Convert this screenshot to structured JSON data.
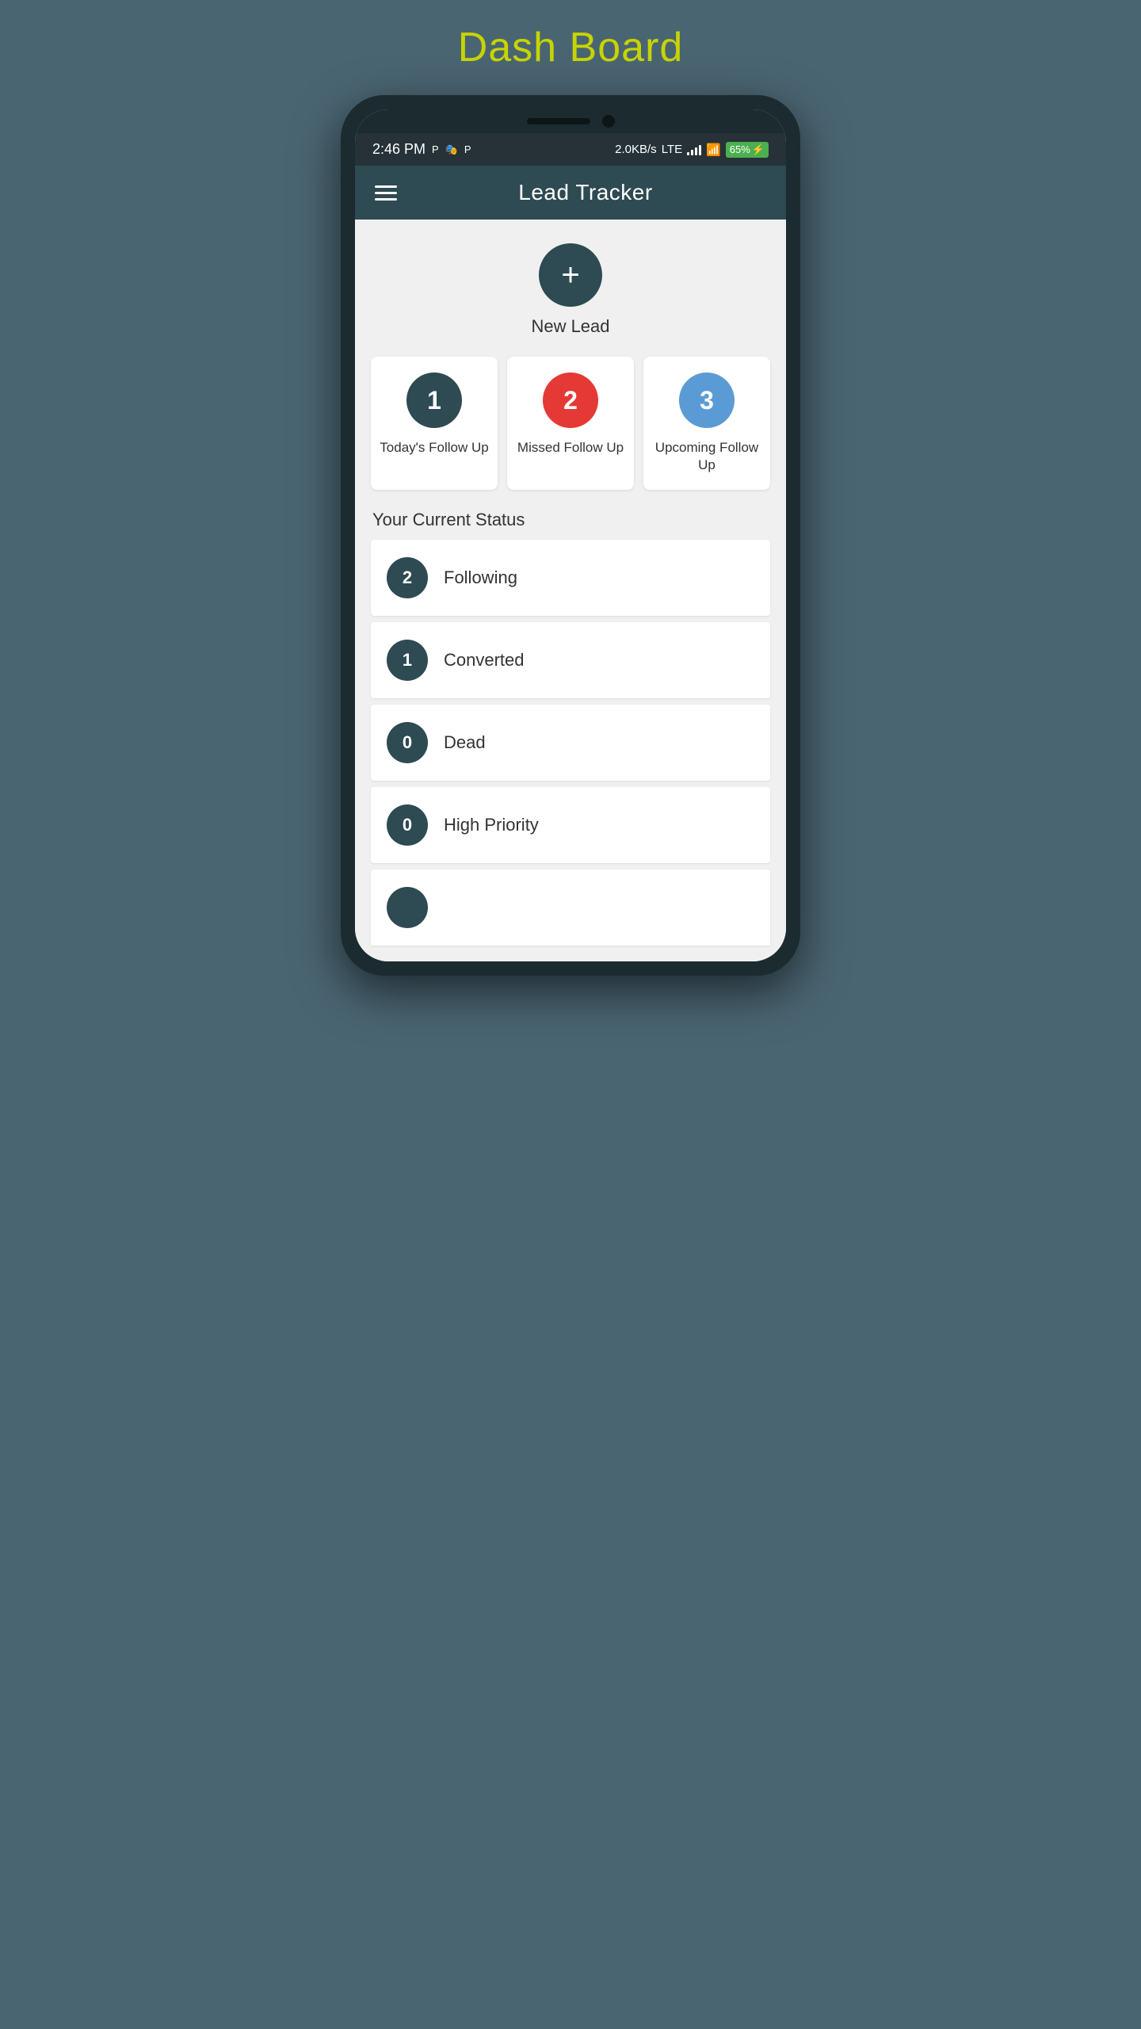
{
  "page": {
    "title_dash": "Dash",
    "title_board": "Board"
  },
  "status_bar": {
    "time": "2:46 PM",
    "network_speed": "2.0KB/s",
    "battery": "65"
  },
  "app_header": {
    "title": "Lead Tracker"
  },
  "new_lead": {
    "label": "New Lead"
  },
  "followup_cards": [
    {
      "count": "1",
      "label": "Today's Follow Up",
      "badge_class": "badge-dark"
    },
    {
      "count": "2",
      "label": "Missed Follow Up",
      "badge_class": "badge-red"
    },
    {
      "count": "3",
      "label": "Upcoming Follow Up",
      "badge_class": "badge-blue"
    }
  ],
  "status_section": {
    "title": "Your Current Status",
    "items": [
      {
        "count": "2",
        "label": "Following"
      },
      {
        "count": "1",
        "label": "Converted"
      },
      {
        "count": "0",
        "label": "Dead"
      },
      {
        "count": "0",
        "label": "High Priority"
      }
    ]
  }
}
